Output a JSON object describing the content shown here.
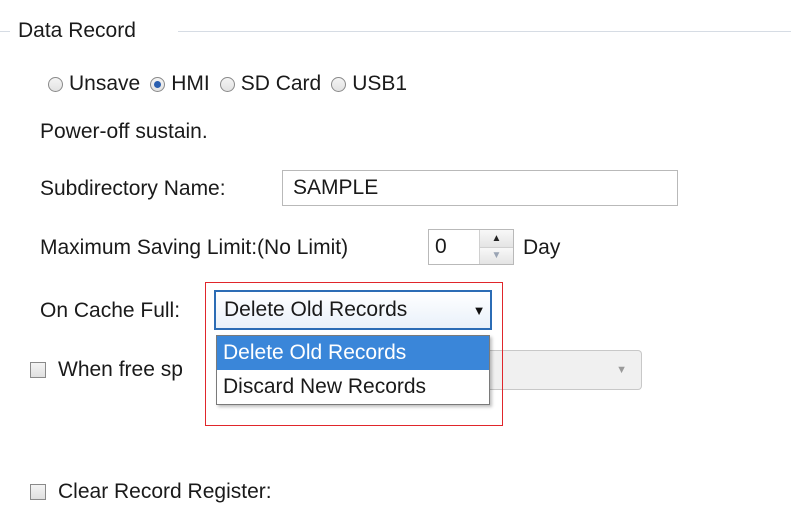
{
  "group": {
    "title": "Data Record"
  },
  "storage": {
    "options": [
      {
        "label": "Unsave",
        "checked": false
      },
      {
        "label": "HMI",
        "checked": true
      },
      {
        "label": "SD Card",
        "checked": false
      },
      {
        "label": "USB1",
        "checked": false
      }
    ],
    "note": "Power-off sustain."
  },
  "subdirectory": {
    "label": "Subdirectory Name:",
    "value": "SAMPLE"
  },
  "saving_limit": {
    "label": "Maximum Saving Limit:(No Limit)",
    "value": "0",
    "unit": "Day"
  },
  "cache_full": {
    "label": "On Cache Full:",
    "selected": "Delete Old Records",
    "options": [
      "Delete Old Records",
      "Discard New Records"
    ],
    "highlighted_index": 0
  },
  "free_space": {
    "label_visible": "When free sp",
    "checked": false
  },
  "clear_register": {
    "label": "Clear Record Register:",
    "checked": false
  },
  "colors": {
    "accent": "#2b6cb5",
    "selection": "#3a86d9",
    "annotation": "#e0262b"
  },
  "icons": {
    "spin_up": "triangle-up",
    "spin_down": "triangle-down",
    "combo": "chevron-down"
  }
}
